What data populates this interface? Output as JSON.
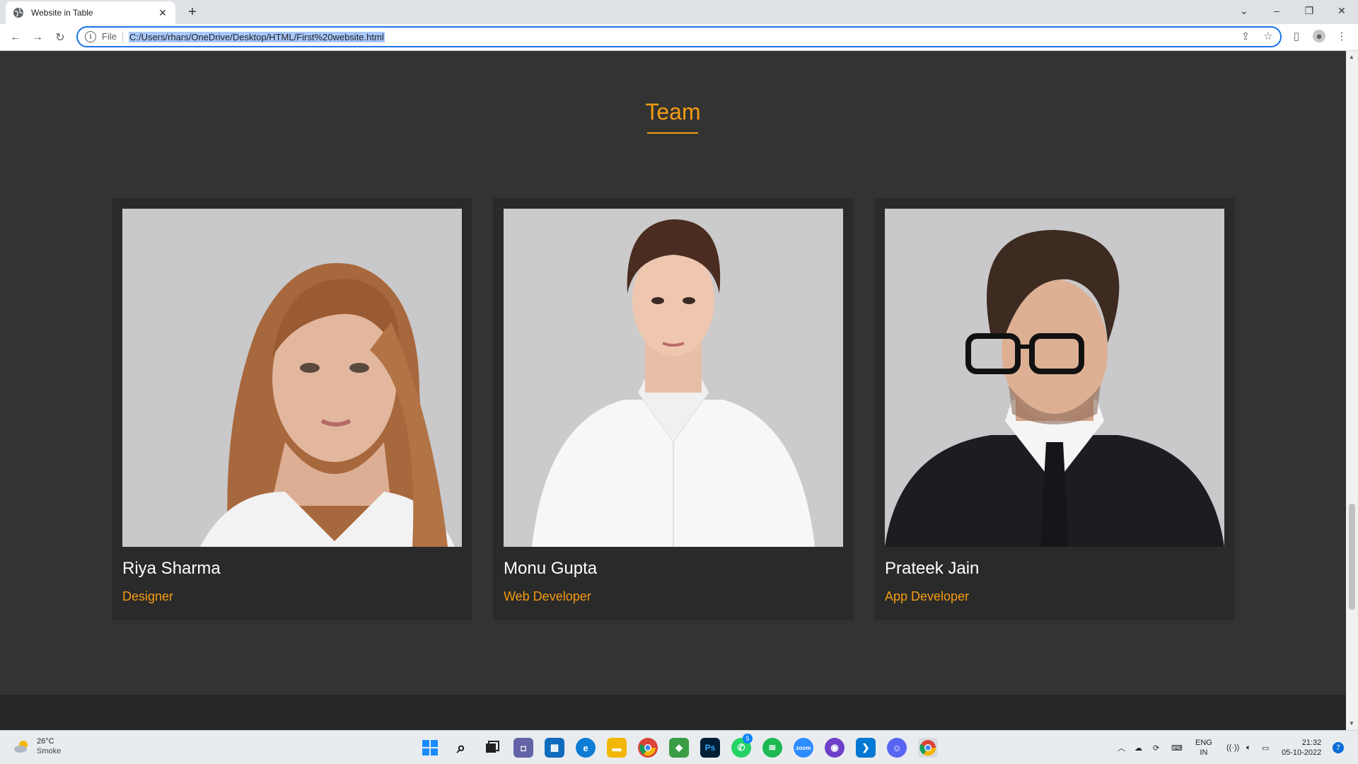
{
  "browser": {
    "tab_title": "Website in Table",
    "address_prefix": "File",
    "url": "C:/Users/rhars/OneDrive/Desktop/HTML/First%20website.html"
  },
  "team": {
    "heading": "Team",
    "members": [
      {
        "name": "Riya Sharma",
        "role": "Designer"
      },
      {
        "name": "Monu Gupta",
        "role": "Web Developer"
      },
      {
        "name": "Prateek Jain",
        "role": "App Developer"
      }
    ]
  },
  "taskbar": {
    "weather_temp": "26°C",
    "weather_desc": "Smoke",
    "lang_top": "ENG",
    "lang_bottom": "IN",
    "time": "21:32",
    "date": "05-10-2022",
    "notification_count": "7",
    "whatsapp_badge": "5",
    "zoom_label": "zoom",
    "ps_label": "Ps"
  },
  "colors": {
    "accent": "#f39c12",
    "page_bg": "#333333",
    "card_bg": "#2a2a2a"
  }
}
